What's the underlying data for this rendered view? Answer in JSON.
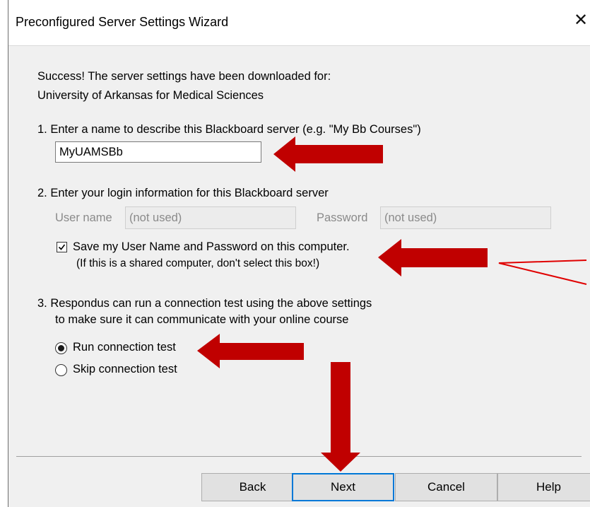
{
  "window": {
    "title": "Preconfigured Server Settings Wizard"
  },
  "intro": {
    "line1": "Success! The server settings have been downloaded for:",
    "line2": "University of Arkansas for Medical Sciences"
  },
  "step1": {
    "label": "1.  Enter a name to describe this Blackboard server (e.g. \"My Bb Courses\")",
    "server_name_value": "MyUAMSBb"
  },
  "step2": {
    "label": "2.  Enter your login information for this Blackboard server",
    "username_label": "User name",
    "username_value": "(not used)",
    "password_label": "Password",
    "password_value": "(not used)",
    "save_checkbox_checked": true,
    "save_label_line1": "Save my User Name and Password on this computer.",
    "save_label_line2": "(If this is a shared computer, don't select this box!)"
  },
  "step3": {
    "label_line1": "3.  Respondus can run a connection test using the above settings",
    "label_line2": "to make sure it can communicate with your online course",
    "options": [
      {
        "label": "Run connection test",
        "selected": true
      },
      {
        "label": "Skip connection test",
        "selected": false
      }
    ]
  },
  "buttons": {
    "back": "Back",
    "next": "Next",
    "cancel": "Cancel",
    "help": "Help"
  },
  "annotation": {
    "arrow_color": "#c00000",
    "callout_color": "#e00000"
  },
  "icons": {
    "close": "close-icon",
    "checkmark": "checkmark-icon"
  }
}
